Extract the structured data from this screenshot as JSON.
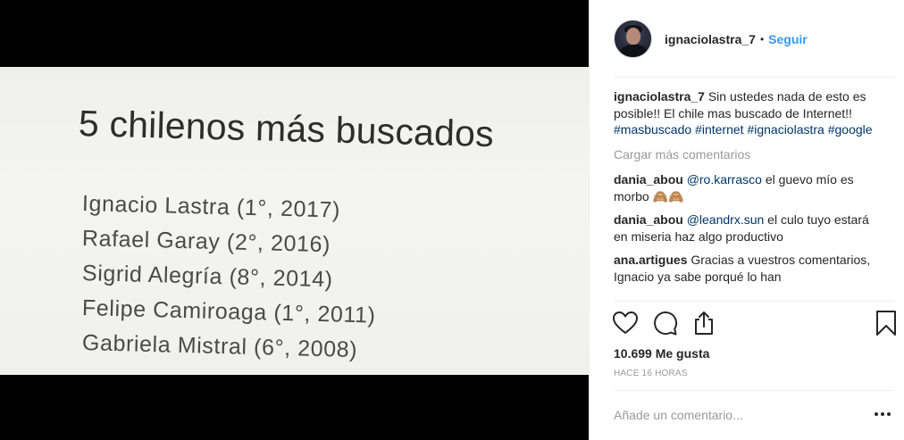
{
  "photo": {
    "title": "5 chilenos más buscados",
    "list": [
      "Ignacio Lastra (1°, 2017)",
      "Rafael Garay (2°, 2016)",
      "Sigrid Alegría (8°, 2014)",
      "Felipe Camiroaga (1°, 2011)",
      "Gabriela Mistral (6°, 2008)"
    ]
  },
  "header": {
    "username": "ignaciolastra_7",
    "separator": "•",
    "follow_label": "Seguir"
  },
  "caption": {
    "username": "ignaciolastra_7",
    "text": "Sin ustedes nada de esto es posible!! El chile mas buscado de Internet!!",
    "hashtags": [
      "#masbuscado",
      "#internet",
      "#ignaciolastra",
      "#google"
    ]
  },
  "load_more_label": "Cargar más comentarios",
  "comments": [
    {
      "username": "dania_abou",
      "mention": "@ro.karrasco",
      "text": "el guevo mío es morbo 🙈🙈"
    },
    {
      "username": "dania_abou",
      "mention": "@leandrx.sun",
      "text": "el culo tuyo estará en miseria haz algo productivo"
    },
    {
      "username": "ana.artigues",
      "mention": "",
      "text": "Gracias a vuestros comentarios, Ignacio ya sabe porqué lo han"
    }
  ],
  "icons": {
    "like": "heart-icon",
    "comment": "comment-bubble-icon",
    "share": "share-icon",
    "save": "bookmark-icon",
    "more": "more-dots-icon"
  },
  "likes_label": "10.699 Me gusta",
  "time_label": "HACE 16 HORAS",
  "add_comment_placeholder": "Añade un comentario...",
  "colors": {
    "link_blue": "#3897f0",
    "hashtag_blue": "#003569",
    "muted_gray": "#999999",
    "text": "#262626"
  }
}
